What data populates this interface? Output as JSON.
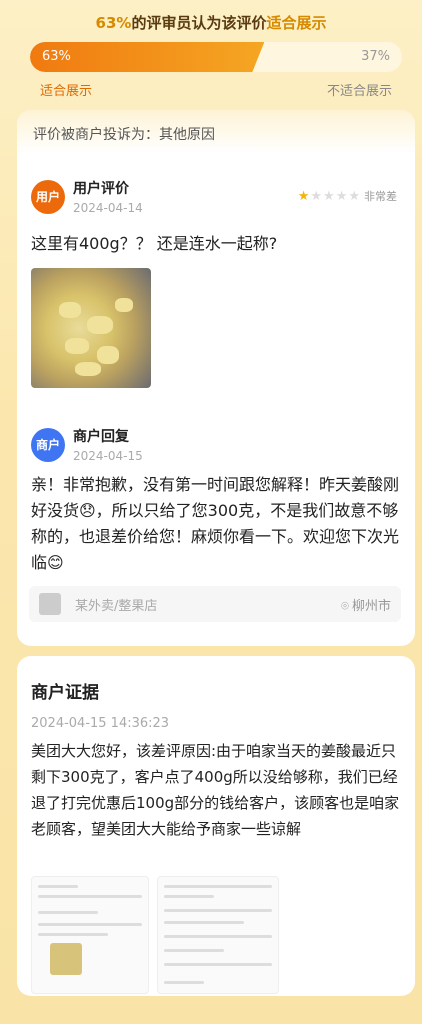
{
  "header": {
    "pct_strong": "63%",
    "title_mid": "的评审员认为该评价",
    "title_hl": "适合展示",
    "left_pct": "63%",
    "right_pct": "37%",
    "left_ratio": 0.63,
    "left_label": "适合展示",
    "right_label": "不适合展示"
  },
  "complaint": {
    "text": "评价被商户投诉为：其他原因"
  },
  "review": {
    "avatar": "用户",
    "name": "用户评价",
    "date": "2024-04-14",
    "stars": 1,
    "max_stars": 5,
    "rating_text": "非常差",
    "text": "这里有400g？？ 还是连水一起称?"
  },
  "reply": {
    "avatar": "商户",
    "name": "商户回复",
    "date": "2024-04-15",
    "text": "亲！非常抱歉，没有第一时间跟您解释！昨天姜酸刚好没货😞，所以只给了您300克，不是我们故意不够称的，也退差价给您！麻烦你看一下。欢迎您下次光临😊"
  },
  "store": {
    "name": "某外卖/整果店",
    "location": "柳州市"
  },
  "evidence": {
    "title": "商户证据",
    "time": "2024-04-15 14:36:23",
    "text": "美团大大您好，该差评原因:由于咱家当天的姜酸最近只剩下300克了，客户点了400g所以没给够称，我们已经退了打完优惠后100g部分的钱给客户，该顾客也是咱家老顾客，望美团大大能给予商家一些谅解"
  },
  "colors": {
    "accent": "#f07a10",
    "merchant": "#3f74f2",
    "star": "#f5b400"
  }
}
